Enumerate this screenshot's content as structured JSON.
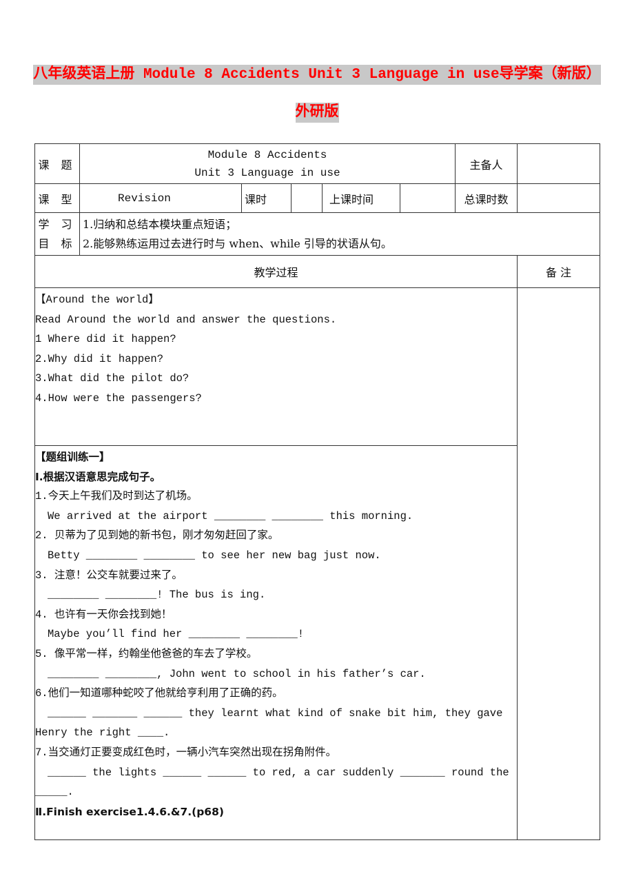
{
  "title": {
    "line1": "八年级英语上册 Module 8 Accidents Unit 3 Language in use导学案（新版）",
    "line2": "外研版",
    "color": "#ff0000",
    "highlight": "#c8c8c8"
  },
  "header": {
    "topic_label": "课  题",
    "topic_line1": "Module 8 Accidents",
    "topic_line2": "Unit 3 Language in use",
    "preparer_label": "主备人",
    "preparer_value": "",
    "type_label": "课 型",
    "type_value": "Revision",
    "period_label": "课时",
    "period_value": "",
    "class_time_label": "上课时间",
    "class_time_value": "",
    "total_periods_label": "总课时数",
    "total_periods_value": "",
    "objectives_label_1": "学 习",
    "objectives_label_2": "目 标",
    "objectives": [
      "1.归纳和总结本模块重点短语；",
      "2.能够熟练运用过去进行时与 when、while 引导的状语从句。"
    ]
  },
  "process": {
    "heading": "教学过程",
    "notes_heading": "备 注",
    "section1": {
      "title": "【Around the world】",
      "intro": "Read Around the world and answer the questions.",
      "questions": [
        "1 Where did it happen?",
        "2.Why did it happen?",
        "3.What did the pilot do?",
        "4.How were the passengers?"
      ]
    },
    "section2": {
      "title": "【题组训练一】",
      "part1_title": "Ⅰ.根据汉语意思完成句子。",
      "items": [
        {
          "cn": "1.今天上午我们及时到达了机场。",
          "en": "We arrived at the airport ________ ________ this morning."
        },
        {
          "cn": "2. 贝蒂为了见到她的新书包，刚才匆匆赶回了家。",
          "en": "Betty ________ ________ to see her new bag just now."
        },
        {
          "cn": "3. 注意！公交车就要过来了。",
          "en": "________ ________! The bus is ing."
        },
        {
          "cn": "4. 也许有一天你会找到她！",
          "en": "Maybe you’ll find her ________ ________!"
        },
        {
          "cn": "5. 像平常一样，约翰坐他爸爸的车去了学校。",
          "en": "________ ________, John went to school in his father’s car."
        },
        {
          "cn": "6.他们一知道哪种蛇咬了他就给亨利用了正确的药。",
          "en": "______  _______  ______  they learnt what kind of snake bit him, they gave",
          "en_cont": "Henry the right ____."
        },
        {
          "cn": "7.当交通灯正要变成红色时，一辆小汽车突然出现在拐角附件。",
          "en": "______ the lights ______  ______ to red, a car suddenly _______ round the",
          "en_cont": "_____."
        }
      ],
      "part2": "Ⅱ.Finish exercise1.4.6.&7.(p68)"
    }
  }
}
